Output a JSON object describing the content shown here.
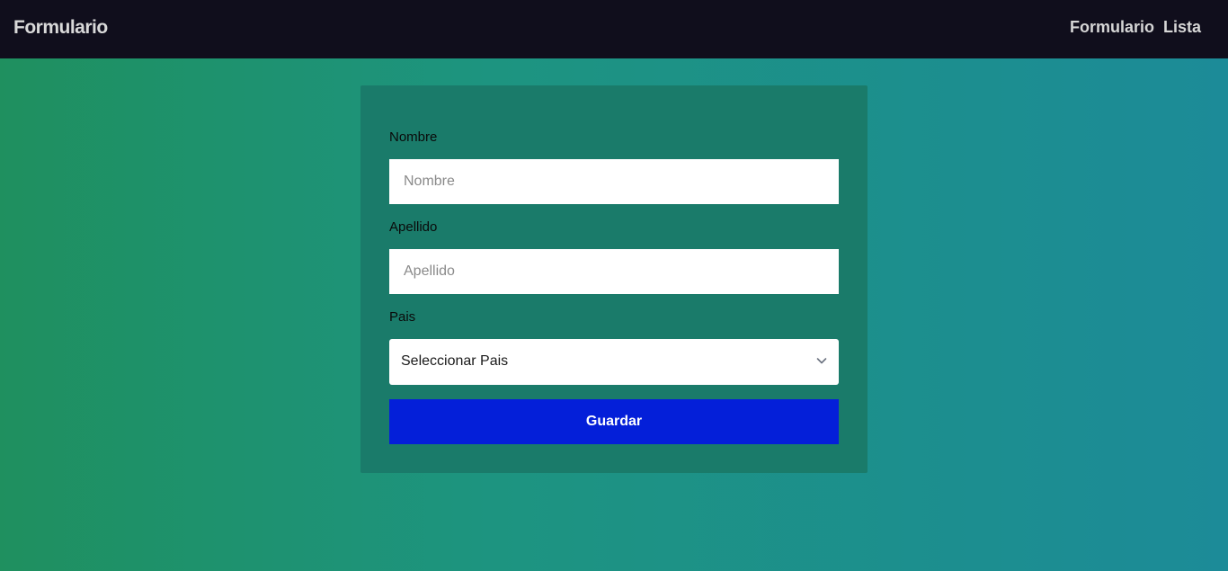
{
  "navbar": {
    "brand": "Formulario",
    "links": [
      "Formulario",
      "Lista"
    ]
  },
  "form": {
    "nombre": {
      "label": "Nombre",
      "placeholder": "Nombre",
      "value": ""
    },
    "apellido": {
      "label": "Apellido",
      "placeholder": "Apellido",
      "value": ""
    },
    "pais": {
      "label": "Pais",
      "selected": "Seleccionar Pais",
      "icon": "chevron-down-icon"
    },
    "save_label": "Guardar"
  },
  "colors": {
    "navbar_bg": "#100e1c",
    "card_bg": "#1a7b6a",
    "button_bg": "#041fd9",
    "gradient_start": "#1f905f",
    "gradient_end": "#1c8b98"
  }
}
